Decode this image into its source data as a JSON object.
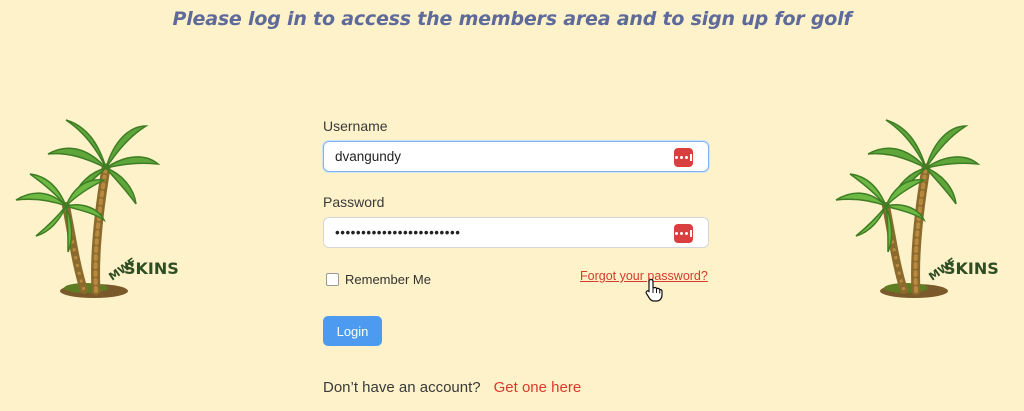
{
  "headline": "Please log in to access the members area and to sign up for golf",
  "logo": {
    "text_top": "MWF",
    "text_main": "SKINS",
    "icon": "palm-trees-logo"
  },
  "form": {
    "username_label": "Username",
    "username_value": "dvangundy",
    "password_label": "Password",
    "password_value": "••••••••••••••••••••••••",
    "remember_label": "Remember Me",
    "forgot_link": "Forgot your password?",
    "login_button": "Login",
    "signup_prompt": "Don’t have an account?",
    "signup_link": "Get one here"
  },
  "colors": {
    "background": "#fdf2c9",
    "headline": "#5e6a9a",
    "link": "#d83a2c",
    "button": "#4c9bf0",
    "password_manager": "#d93f3f"
  }
}
